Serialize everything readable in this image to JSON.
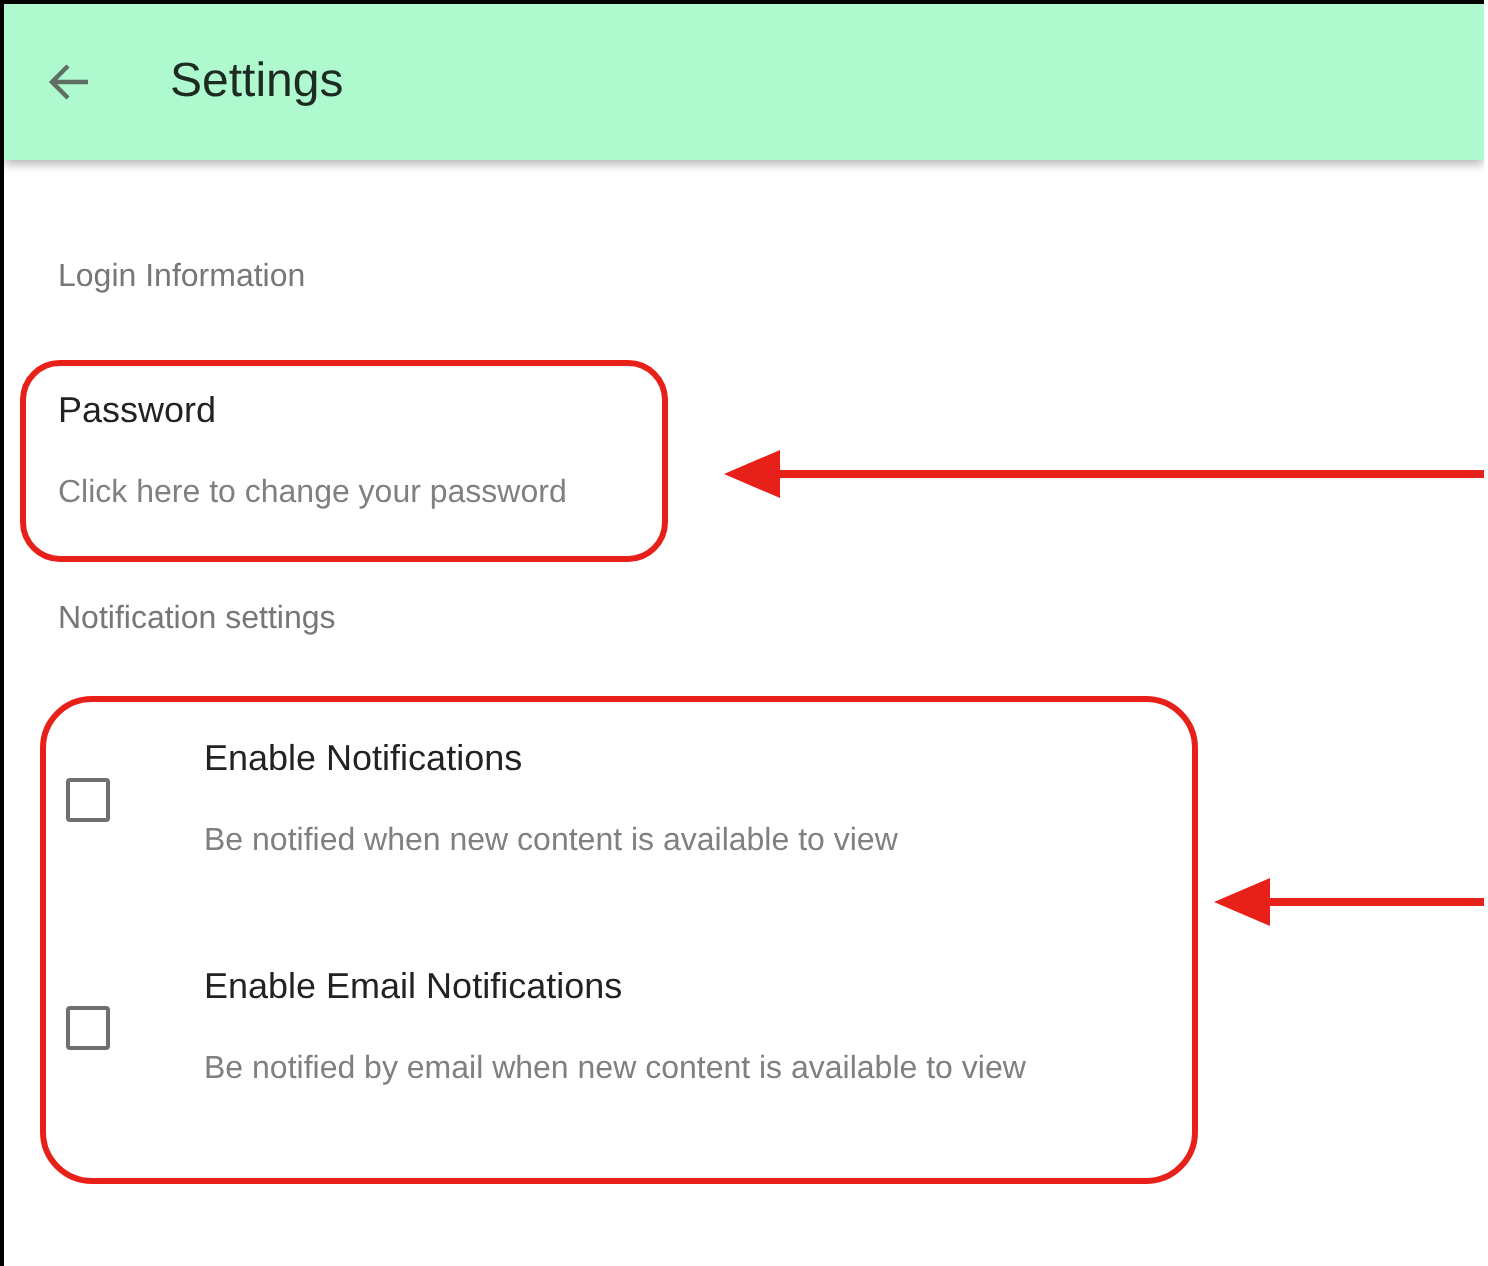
{
  "app_bar": {
    "title": "Settings"
  },
  "sections": [
    {
      "header": "Login Information",
      "items": [
        {
          "kind": "link",
          "title": "Password",
          "summary": "Click here to change your password"
        }
      ]
    },
    {
      "header": "Notification settings",
      "items": [
        {
          "kind": "checkbox",
          "title": "Enable Notifications",
          "summary": "Be notified when new content is available to view",
          "checked": false
        },
        {
          "kind": "checkbox",
          "title": "Enable Email Notifications",
          "summary": "Be notified by email when new content is available to view",
          "checked": false
        }
      ]
    }
  ]
}
